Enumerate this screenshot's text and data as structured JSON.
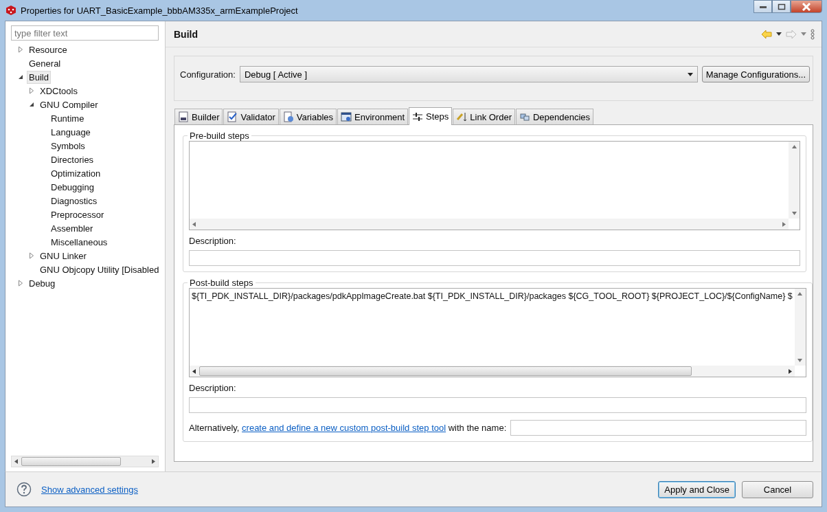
{
  "window": {
    "title": "Properties for UART_BasicExample_bbbAM335x_armExampleProject"
  },
  "filter": {
    "placeholder": "type filter text"
  },
  "tree": [
    {
      "label": "Resource",
      "expanded": false,
      "selected": false
    },
    {
      "label": "General",
      "selected": false
    },
    {
      "label": "Build",
      "expanded": true,
      "selected": true,
      "children": [
        {
          "label": "XDCtools",
          "expanded": false,
          "selected": false
        },
        {
          "label": "GNU Compiler",
          "expanded": true,
          "selected": false,
          "children": [
            {
              "label": "Runtime",
              "selected": false
            },
            {
              "label": "Language",
              "selected": false
            },
            {
              "label": "Symbols",
              "selected": false
            },
            {
              "label": "Directories",
              "selected": false
            },
            {
              "label": "Optimization",
              "selected": false
            },
            {
              "label": "Debugging",
              "selected": false
            },
            {
              "label": "Diagnostics",
              "selected": false
            },
            {
              "label": "Preprocessor",
              "selected": false
            },
            {
              "label": "Assembler",
              "selected": false
            },
            {
              "label": "Miscellaneous",
              "selected": false
            }
          ]
        },
        {
          "label": "GNU Linker",
          "expanded": false,
          "selected": false
        },
        {
          "label": "GNU Objcopy Utility  [Disabled",
          "selected": false
        }
      ]
    },
    {
      "label": "Debug",
      "expanded": false,
      "selected": false
    }
  ],
  "page_title": "Build",
  "configuration": {
    "label": "Configuration:",
    "value": "Debug  [ Active ]",
    "manage_button": "Manage Configurations..."
  },
  "tabs": [
    {
      "label": "Builder",
      "selected": false
    },
    {
      "label": "Validator",
      "selected": false
    },
    {
      "label": "Variables",
      "selected": false
    },
    {
      "label": "Environment",
      "selected": false
    },
    {
      "label": "Steps",
      "selected": true
    },
    {
      "label": "Link Order",
      "selected": false
    },
    {
      "label": "Dependencies",
      "selected": false
    }
  ],
  "pre_build": {
    "title": "Pre-build steps",
    "description_label": "Description:"
  },
  "post_build": {
    "title": "Post-build steps",
    "command": "${TI_PDK_INSTALL_DIR}/packages/pdkAppImageCreate.bat ${TI_PDK_INSTALL_DIR}/packages ${CG_TOOL_ROOT} ${PROJECT_LOC}/${ConfigName} $",
    "description_label": "Description:"
  },
  "custom_tool": {
    "before": "Alternatively, ",
    "link": "create and define a new custom post-build step tool",
    "after": " with the name:"
  },
  "footer": {
    "link": "Show advanced settings",
    "buttons": [
      "Apply and Close",
      "Cancel"
    ]
  }
}
